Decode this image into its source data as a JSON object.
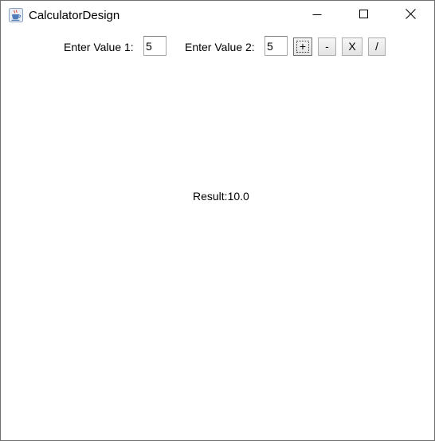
{
  "window": {
    "title": "CalculatorDesign",
    "app_icon": "java-cup-icon",
    "controls": {
      "minimize_icon": "minimize-icon",
      "maximize_icon": "maximize-icon",
      "close_icon": "close-icon"
    }
  },
  "form": {
    "value1_label": "Enter Value 1:",
    "value1": "5",
    "value2_label": "Enter Value 2:",
    "value2": "5",
    "buttons": {
      "add": "+",
      "subtract": "-",
      "multiply": "X",
      "divide": "/"
    }
  },
  "result": {
    "text": "Result:10.0"
  },
  "colors": {
    "window_background": "#ffffff",
    "window_border": "#6f6f6f",
    "button_border": "#adadad",
    "text": "#000000"
  }
}
